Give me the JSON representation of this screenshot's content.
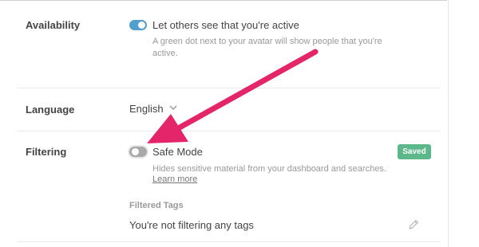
{
  "availability": {
    "label": "Availability",
    "toggle_state": "on",
    "option_label": "Let others see that you're active",
    "help_line1": "A green dot next to your avatar will show people that you're",
    "help_line2": "active."
  },
  "language": {
    "label": "Language",
    "selected": "English"
  },
  "filtering": {
    "label": "Filtering",
    "toggle_state": "off",
    "option_label": "Safe Mode",
    "status_badge": "Saved",
    "help_text": "Hides sensitive material from your dashboard and searches.",
    "learn_more": "Learn more",
    "tags_heading": "Filtered Tags",
    "tags_empty": "You're not filtering any tags"
  },
  "colors": {
    "toggle_on": "#529ecc",
    "toggle_off": "#a9a9a9",
    "saved_badge": "#5cb88a",
    "annotation_arrow": "#e5256a"
  },
  "icons": {
    "language_dropdown": "chevron-down-icon",
    "edit_tags": "pencil-icon"
  }
}
